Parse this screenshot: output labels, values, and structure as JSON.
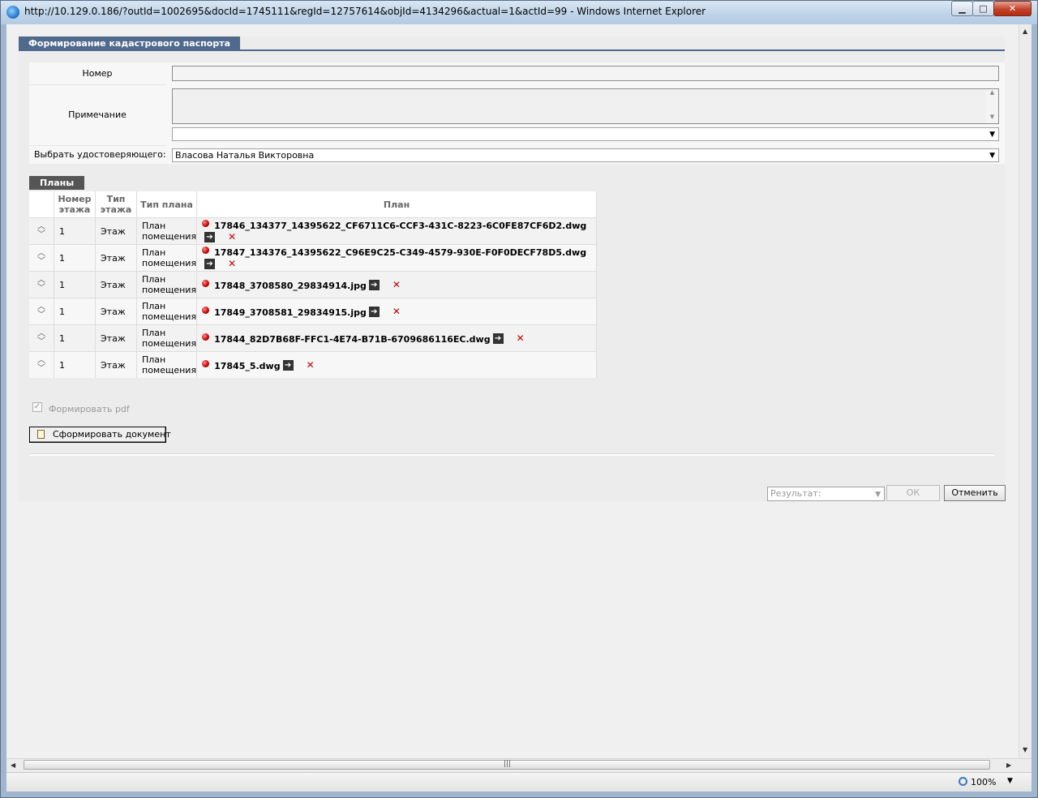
{
  "window": {
    "title": "http://10.129.0.186/?outId=1002695&docId=1745111&regId=12757614&objId=4134296&actual=1&actId=99 - Windows Internet Explorer",
    "minimize": "▁",
    "maximize": "□",
    "close": "✕"
  },
  "panel": {
    "title": "Формирование кадастрового паспорта"
  },
  "form": {
    "number_label": "Номер",
    "number_value": "",
    "note_label": "Примечание",
    "note_value": "",
    "note_select_value": "",
    "certifier_label": "Выбрать удостоверяющего:",
    "certifier_value": "Власова Наталья Викторовна"
  },
  "plans": {
    "tab_label": "Планы",
    "columns": {
      "floor_number": "Номер этажа",
      "floor_type": "Тип этажа",
      "plan_type": "Тип плана",
      "plan": "План"
    },
    "rows": [
      {
        "floor": "1",
        "floor_type": "Этаж",
        "plan_type": "План помещения",
        "file": "17846_134377_14395622_CF6711C6-CCF3-431C-8223-6C0FE87CF6D2.dwg"
      },
      {
        "floor": "1",
        "floor_type": "Этаж",
        "plan_type": "План помещения",
        "file": "17847_134376_14395622_C96E9C25-C349-4579-930E-F0F0DECF78D5.dwg"
      },
      {
        "floor": "1",
        "floor_type": "Этаж",
        "plan_type": "План помещения",
        "file": "17848_3708580_29834914.jpg"
      },
      {
        "floor": "1",
        "floor_type": "Этаж",
        "plan_type": "План помещения",
        "file": "17849_3708581_29834915.jpg"
      },
      {
        "floor": "1",
        "floor_type": "Этаж",
        "plan_type": "План помещения",
        "file": "17844_82D7B68F-FFC1-4E74-B71B-6709686116EC.dwg"
      },
      {
        "floor": "1",
        "floor_type": "Этаж",
        "plan_type": "План помещения",
        "file": "17845_5.dwg"
      }
    ]
  },
  "options": {
    "generate_pdf_label": "Формировать pdf",
    "generate_pdf_checked": true
  },
  "actions": {
    "generate_button": "Сформировать документ",
    "result_placeholder": "Результат:",
    "ok_button": "ОК",
    "cancel_button": "Отменить"
  },
  "statusbar": {
    "zoom": "100%"
  },
  "colors": {
    "panel_header": "#4f6a8c",
    "plans_tab": "#555555",
    "delete_icon": "#c00000",
    "status_dot": "#c00000"
  }
}
